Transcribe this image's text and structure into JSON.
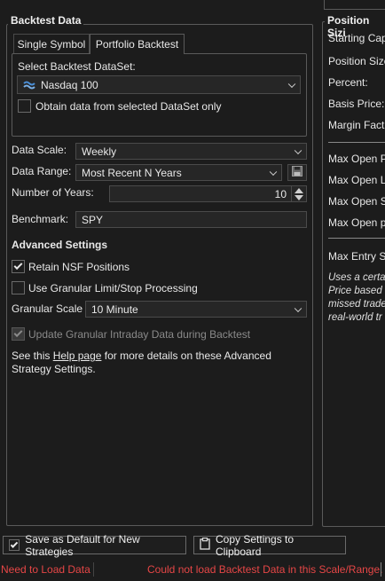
{
  "backtest": {
    "title": "Backtest Data",
    "tabs": [
      "Single Symbol",
      "Portfolio Backtest"
    ],
    "select_dataset_label": "Select Backtest DataSet:",
    "dataset_value": "Nasdaq 100",
    "obtain_only_label": "Obtain data from selected DataSet only",
    "obtain_only_checked": false,
    "data_scale_label": "Data Scale:",
    "data_scale_value": "Weekly",
    "data_range_label": "Data Range:",
    "data_range_value": "Most Recent N Years",
    "num_years_label": "Number of Years:",
    "num_years_value": "10",
    "benchmark_label": "Benchmark:",
    "benchmark_value": "SPY",
    "advanced_title": "Advanced Settings",
    "retain_nsf_label": "Retain NSF Positions",
    "retain_nsf_checked": true,
    "granular_limit_label": "Use Granular Limit/Stop Processing",
    "granular_limit_checked": false,
    "granular_scale_label": "Granular Scale",
    "granular_scale_value": "10 Minute",
    "update_granular_label": "Update Granular Intraday Data during Backtest",
    "update_granular_checked": true,
    "help_prefix": "See this ",
    "help_link": "Help page",
    "help_suffix": " for more details on these Advanced",
    "help_line2": "Strategy Settings."
  },
  "position": {
    "title": "Position Sizi",
    "labels": [
      "Starting Cap",
      "Position Size",
      "Percent:",
      "Basis Price:",
      "Margin Fact"
    ],
    "max_labels": [
      "Max Open P",
      "Max Open L",
      "Max Open S",
      "Max Open p"
    ],
    "max_entry_label": "Max Entry Si",
    "note_lines": [
      "Uses a certa",
      "Price based",
      "missed trade",
      "real-world tr"
    ]
  },
  "footer": {
    "save_default_label": "Save as Default for New Strategies",
    "save_default_checked": true,
    "copy_label": "Copy Settings to Clipboard"
  },
  "status": {
    "left": "Need to Load Data",
    "right": "Could not load Backtest Data in this Scale/Range."
  },
  "colors": {
    "background": "#1c1c1c",
    "status_error": "#e64646",
    "dataset_icon": "#4a8fd8"
  }
}
